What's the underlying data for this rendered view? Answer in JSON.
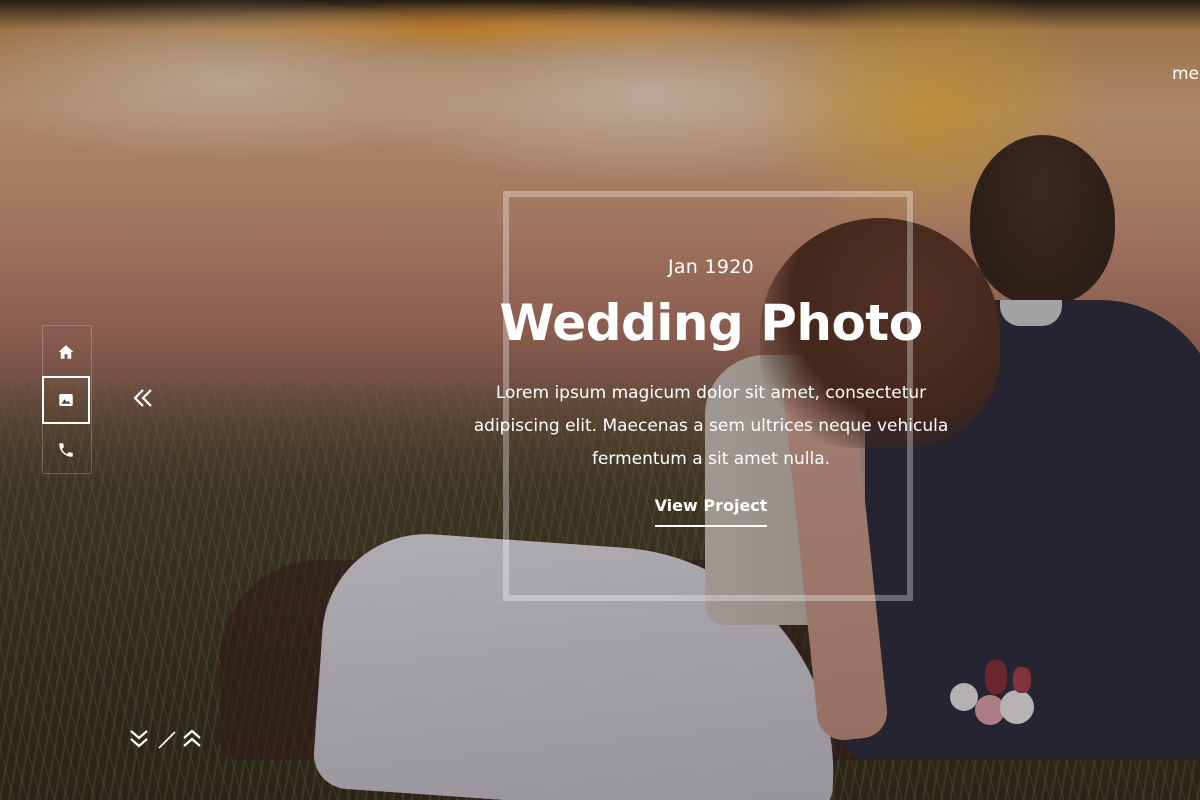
{
  "hero": {
    "date": "Jan 1920",
    "title": "Wedding Photo",
    "description": "Lorem ipsum magicum dolor sit amet, consectetur adipiscing elit. Maecenas a sem ultrices neque vehicula fermentum a sit amet nulla.",
    "cta_label": "View Project"
  },
  "header": {
    "menu_label": "me"
  },
  "sidebar": {
    "items": [
      {
        "name": "home",
        "icon": "home-icon",
        "active": false
      },
      {
        "name": "gallery",
        "icon": "image-icon",
        "active": true
      },
      {
        "name": "contact",
        "icon": "phone-icon",
        "active": false
      }
    ]
  },
  "colors": {
    "text": "#ffffff",
    "frame_border": "rgba(255,255,255,0.32)"
  }
}
